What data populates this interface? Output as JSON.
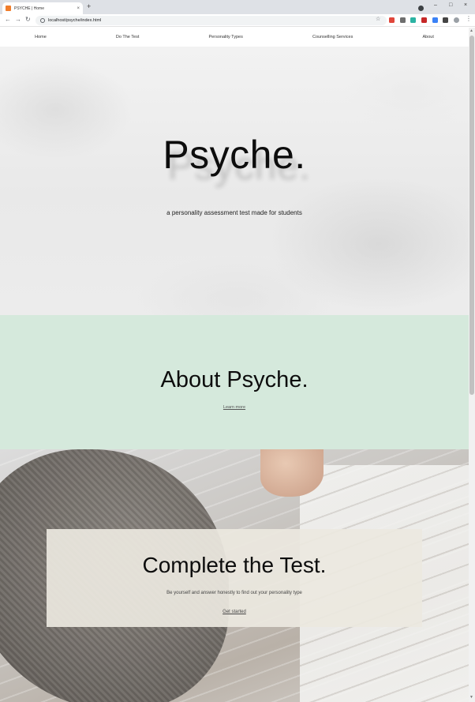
{
  "browser": {
    "tab_title": "PSYCHE | Home",
    "tab_close": "×",
    "new_tab": "+",
    "url": "localhost/psyche/index.html",
    "controls": {
      "minimize": "–",
      "maximize": "□",
      "close": "×"
    },
    "nav": {
      "back": "←",
      "forward": "→",
      "reload": "↻"
    },
    "star": "☆",
    "menu": "⋮",
    "extension_colors": [
      "#e0463b",
      "#6e6e6e",
      "#2bb3a3",
      "#c62828",
      "#3b82f6",
      "#444444",
      "#9aa0a6"
    ]
  },
  "site_nav": {
    "items": [
      "Home",
      "Do The Test",
      "Personality Types",
      "Counselling Services",
      "About"
    ]
  },
  "hero": {
    "title": "Psyche.",
    "subtitle": "a personality assessment test made for students"
  },
  "about": {
    "title": "About Psyche.",
    "link": "Learn more",
    "background": "#d5e9dc"
  },
  "test": {
    "title": "Complete the Test.",
    "subtitle": "Be yourself and answer honestly to find out your personality type",
    "link": "Get started"
  },
  "scrollbar": {
    "up": "▲",
    "down": "▼"
  }
}
